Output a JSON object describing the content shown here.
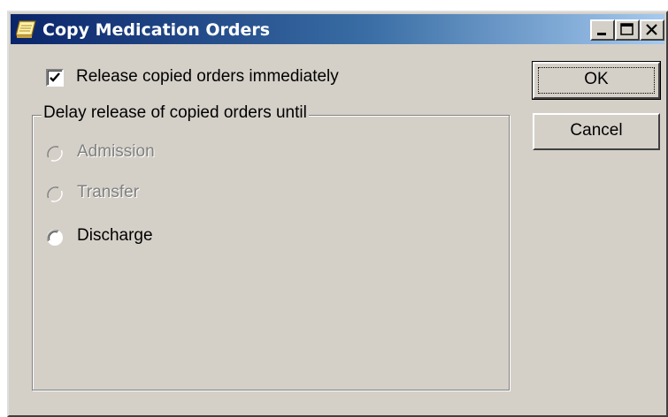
{
  "window": {
    "title": "Copy Medication Orders",
    "title_icon": "notepad-icon",
    "controls": [
      "minimize-icon",
      "maximize-icon",
      "close-icon"
    ]
  },
  "release_checkbox": {
    "label": "Release copied orders immediately",
    "checked": true
  },
  "delay_group": {
    "legend": "Delay release of copied orders until",
    "options": [
      {
        "label": "Admission",
        "enabled": false,
        "selected": false
      },
      {
        "label": "Transfer",
        "enabled": false,
        "selected": false
      },
      {
        "label": "Discharge",
        "enabled": true,
        "selected": false
      }
    ]
  },
  "buttons": {
    "ok_label": "OK",
    "cancel_label": "Cancel"
  },
  "colors": {
    "face": "#d4d0c8",
    "title_start": "#0a246a",
    "title_end": "#a6caf0",
    "disabled_text": "#808080"
  }
}
